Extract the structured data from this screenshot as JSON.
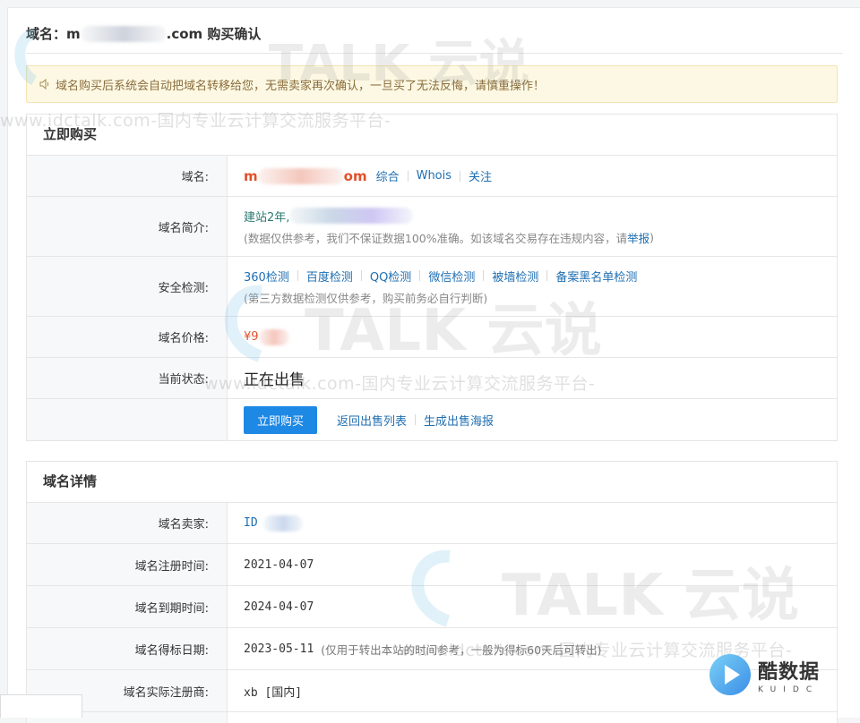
{
  "page": {
    "title_prefix": "域名：m",
    "title_suffix": ".com 购买确认"
  },
  "notice": {
    "text": "域名购买后系统会自动把域名转移给您，无需卖家再次确认，一旦买了无法反悔，请慎重操作！"
  },
  "buy_panel": {
    "heading": "立即购买",
    "domain_label": "域名:",
    "domain_prefix": "m",
    "domain_suffix": "om",
    "links": [
      "综合",
      "Whois",
      "关注"
    ],
    "intro_label": "域名简介:",
    "intro_text": "建站2年,",
    "disclaimer_before": "(数据仅供参考，我们不保证数据100%准确。如该域名交易存在违规内容，请 ",
    "report_link": "举报",
    "disclaimer_after": ")",
    "security_label": "安全检测:",
    "security_links": [
      "360检测",
      "百度检测",
      "QQ检测",
      "微信检测",
      "被墙检测",
      "备案黑名单检测"
    ],
    "security_note": "(第三方数据检测仅供参考，购买前务必自行判断)",
    "price_label": "域名价格:",
    "price_text": "¥9",
    "status_label": "当前状态:",
    "status_text": "正在出售",
    "buy_button": "立即购买",
    "back_link": "返回出售列表",
    "poster_link": "生成出售海报"
  },
  "detail_panel": {
    "heading": "域名详情",
    "rows": [
      {
        "label": "域名卖家:",
        "value": "ID",
        "note": ""
      },
      {
        "label": "域名注册时间:",
        "value": "2021-04-07",
        "note": ""
      },
      {
        "label": "域名到期时间:",
        "value": "2024-04-07",
        "note": ""
      },
      {
        "label": "域名得标日期:",
        "value": "2023-05-11",
        "note": "(仅用于转出本站的时间参考，一般为得标60天后可转出)"
      },
      {
        "label": "域名实际注册商:",
        "value": "xb [国内]",
        "note": ""
      }
    ]
  },
  "watermark": {
    "brand": "TALK 云说",
    "url_text": "www.idctalk.com-国内专业云计算交流服务平台-"
  },
  "badge": {
    "main": "酷数据",
    "sub": "KUIDC"
  }
}
